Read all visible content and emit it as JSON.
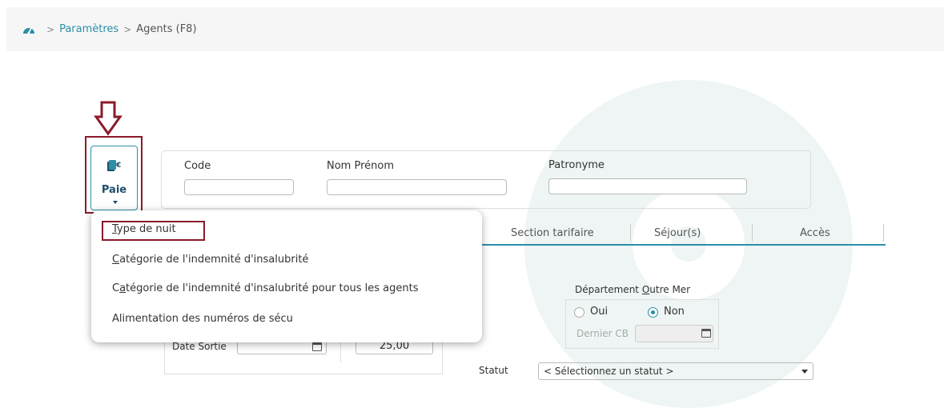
{
  "breadcrumb": {
    "home_icon": "dashboard-icon",
    "separator": ">",
    "link": "Paramètres",
    "current": "Agents (F8)"
  },
  "toolbar": {
    "paie_label": "Paie",
    "paie_icon": "payroll-icon"
  },
  "fields": {
    "code_label": "Code",
    "code_value": "",
    "nom_label": "Nom Prénom",
    "nom_value": "",
    "patronyme_label": "Patronyme",
    "patronyme_value": ""
  },
  "tabs": [
    "Section tarifaire",
    "Séjour(s)",
    "Accès"
  ],
  "menu": {
    "items": [
      {
        "pre": "",
        "ul": "T",
        "post": "ype de nuit"
      },
      {
        "pre": "",
        "ul": "C",
        "post": "atégorie de l'indemnité d'insalubrité"
      },
      {
        "pre": "C",
        "ul": "a",
        "post": "tégorie de l'indemnité d'insalubrité pour tous les agents"
      },
      {
        "pre": "Alimentation des numéros de sécu",
        "ul": "",
        "post": ""
      }
    ]
  },
  "departement": {
    "title_pre": "Département ",
    "title_ul": "O",
    "title_post": "utre Mer",
    "oui": "Oui",
    "non": "Non",
    "selected": "Non",
    "dernier_cb_label": "Dernier CB",
    "dernier_cb_value": ""
  },
  "sortie": {
    "date_label": "Date Sortie",
    "date_value": "",
    "number_value": "25,00"
  },
  "statut": {
    "label": "Statut",
    "placeholder": "< Sélectionnez un statut >"
  },
  "colors": {
    "accent": "#2b8fa8",
    "annotation": "#8b1a2b",
    "topbar": "#f6f6f6"
  }
}
